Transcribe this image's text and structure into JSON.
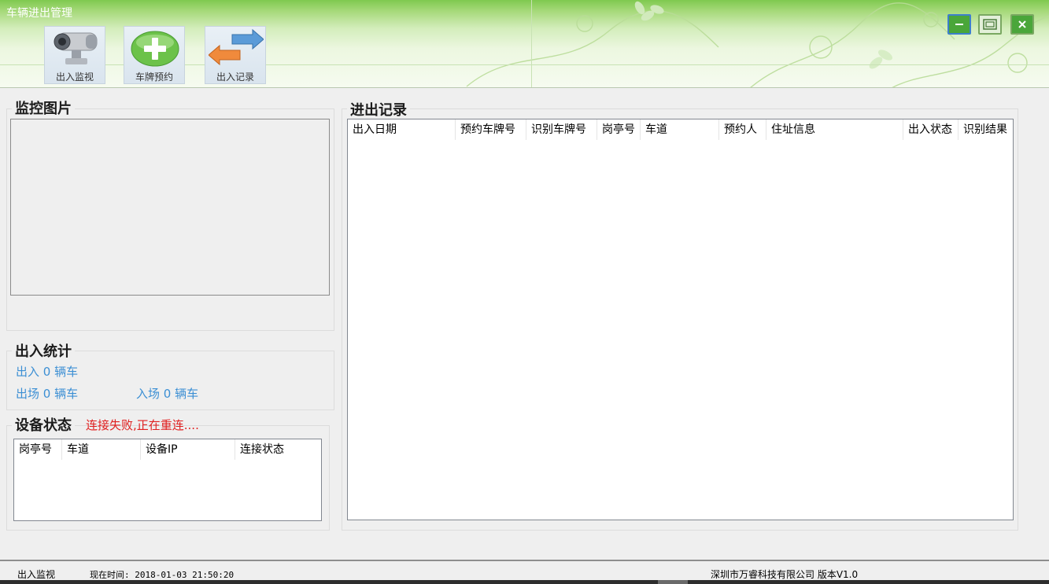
{
  "window": {
    "title": "车辆进出管理"
  },
  "toolbar": {
    "buttons": [
      {
        "label": "出入监视",
        "icon": "camera-icon"
      },
      {
        "label": "车牌预约",
        "icon": "plus-circle-icon"
      },
      {
        "label": "出入记录",
        "icon": "swap-arrows-icon"
      }
    ]
  },
  "window_controls": {
    "minimize": "minimize-icon",
    "maximize": "maximize-icon",
    "close": "close-icon"
  },
  "monitor": {
    "title": "监控图片"
  },
  "stats": {
    "title": "出入统计",
    "entry_text": "出入 0 辆车",
    "exit_text": "出场 0 辆车",
    "enter_text": "入场 0 辆车"
  },
  "device": {
    "title": "设备状态",
    "status_text": "连接失败,正在重连....",
    "columns": [
      "岗亭号",
      "车道",
      "设备IP",
      "连接状态"
    ]
  },
  "records": {
    "title": "进出记录",
    "columns": [
      "出入日期",
      "预约车牌号",
      "识别车牌号",
      "岗亭号",
      "车道",
      "预约人",
      "住址信息",
      "出入状态",
      "识别结果"
    ]
  },
  "statusbar": {
    "mode": "出入监视",
    "time_text": "现在时间: 2018-01-03 21:50:20",
    "company_text": "深圳市万睿科技有限公司 版本V1.0"
  },
  "colors": {
    "stat_text": "#3c8fd4",
    "error_text": "#e02020",
    "title_bar": "#7fc94f"
  }
}
